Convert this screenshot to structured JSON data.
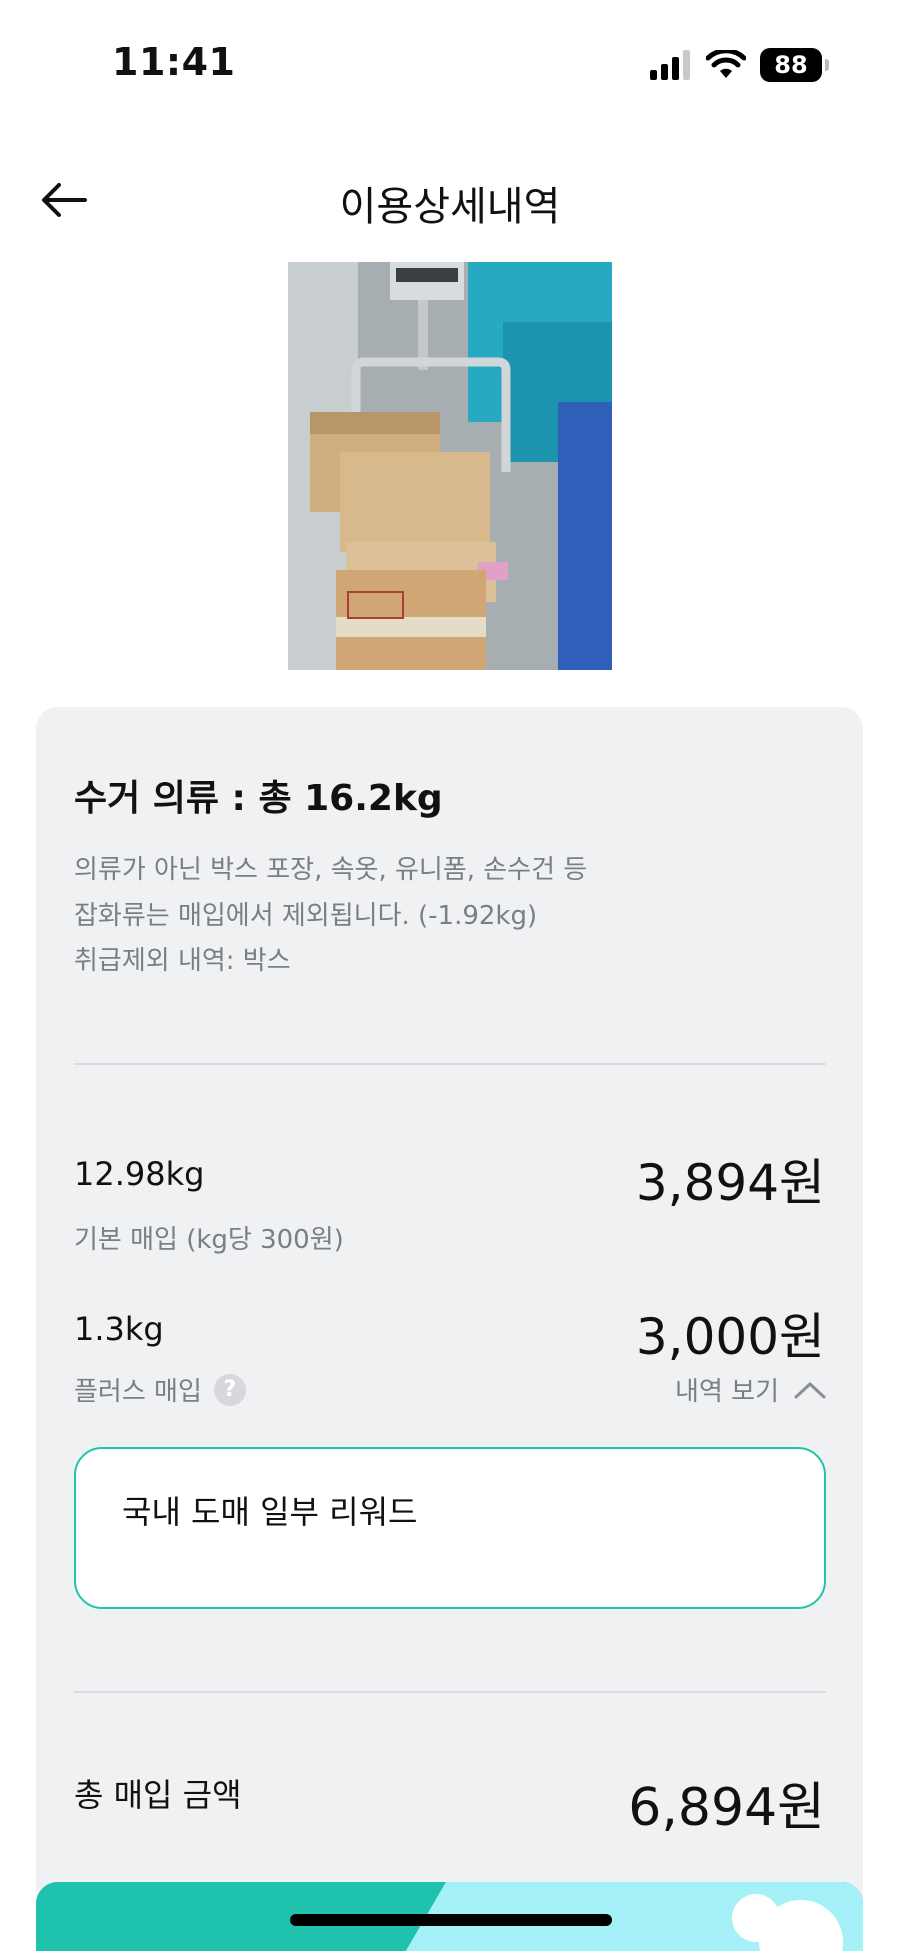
{
  "status_bar": {
    "time": "11:41",
    "battery": "88"
  },
  "header": {
    "title": "이용상세내역"
  },
  "summary": {
    "title": "수거 의류 : 총 16.2kg",
    "notes": [
      "의류가 아닌 박스 포장, 속옷, 유니폼, 손수건 등",
      "잡화류는 매입에서 제외됩니다. (-1.92kg)",
      "취급제외 내역: 박스"
    ]
  },
  "basic": {
    "weight": "12.98kg",
    "label": "기본 매입 (kg당 300원)",
    "amount": "3,894원"
  },
  "plus": {
    "weight": "1.3kg",
    "label": "플러스 매입",
    "help": "?",
    "amount": "3,000원",
    "toggle_label": "내역 보기"
  },
  "reward": {
    "text": "국내 도매 일부 리워드"
  },
  "total": {
    "label": "총 매입 금액",
    "amount": "6,894원"
  },
  "colors": {
    "accent": "#20c4ae",
    "card": "#f0f1f3",
    "muted": "#7a7e85"
  }
}
